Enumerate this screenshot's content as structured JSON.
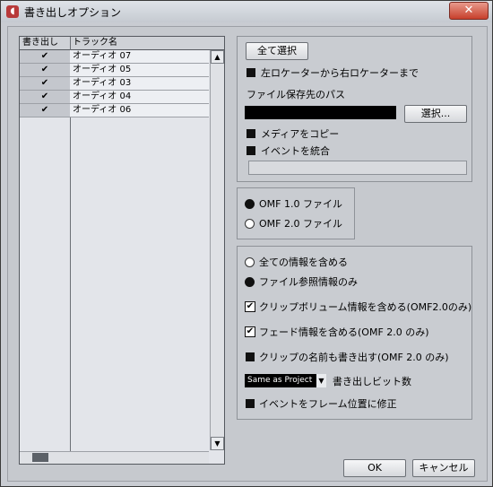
{
  "window": {
    "title": "書き出しオプション",
    "close_glyph": "✕"
  },
  "tracks": {
    "headers": {
      "export": "書き出し",
      "name": "トラック名"
    },
    "rows": [
      {
        "checked": "✔",
        "name": "オーディオ 07"
      },
      {
        "checked": "✔",
        "name": "オーディオ 05"
      },
      {
        "checked": "✔",
        "name": "オーディオ 03"
      },
      {
        "checked": "✔",
        "name": "オーディオ 04"
      },
      {
        "checked": "✔",
        "name": "オーディオ 06"
      }
    ]
  },
  "export_group": {
    "select_all": "全て選択",
    "locators_only": "左ロケーターから右ロケーターまで",
    "save_path_label": "ファイル保存先のパス",
    "browse": "選択...",
    "copy_media": "メディアをコピー",
    "consolidate_events": "イベントを統合"
  },
  "omf_version": {
    "options": [
      "OMF 1.0 ファイル",
      "OMF 2.0 ファイル"
    ],
    "selected": "OMF 1.0 ファイル"
  },
  "content": {
    "include_all": "全ての情報を含める",
    "references_only": "ファイル参照情報のみ",
    "selected": "ファイル参照情報のみ",
    "clip_volume": "クリップボリューム情報を含める(OMF2.0のみ)",
    "clip_volume_checked": true,
    "fades": "フェード情報を含める(OMF 2.0 のみ)",
    "fades_checked": true,
    "clip_names": "クリップの名前も書き出す(OMF 2.0 のみ)",
    "bit_depth_value": "Same as Project",
    "bit_depth_label": "書き出しビット数",
    "snap_to_frame": "イベントをフレーム位置に修正",
    "check_glyph": "✔"
  },
  "footer": {
    "ok": "OK",
    "cancel": "キャンセル"
  },
  "colors": {
    "close_button": "#c7402c",
    "panel": "#c9ccd1",
    "list_bg": "#e3e5ea"
  }
}
